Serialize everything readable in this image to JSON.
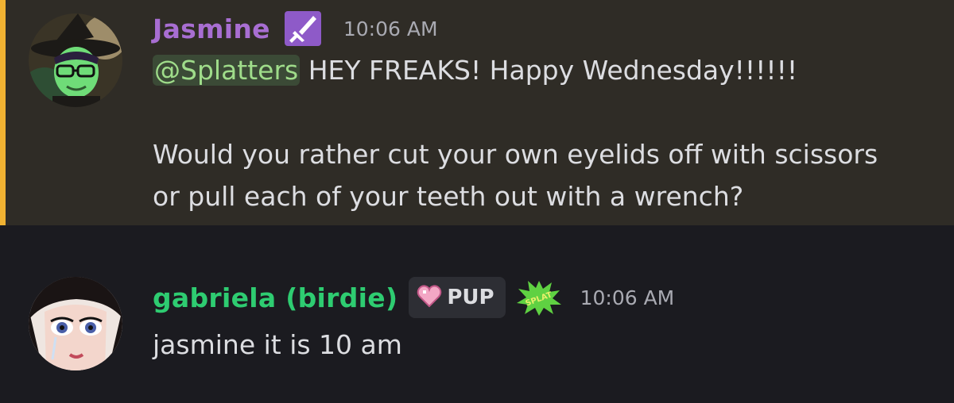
{
  "messages": [
    {
      "author": "Jasmine",
      "role_icon": "sword-icon",
      "timestamp": "10:06 AM",
      "mention": "@Splatters",
      "line1_text": " HEY FREAKS! Happy Wednesday!!!!!!",
      "line2": "Would you rather cut your own eyelids off with scissors",
      "line3": "or pull each of your teeth out with a wrench?",
      "author_color": "#a86ed2",
      "highlighted": true,
      "highlight_color": "#f0b232"
    },
    {
      "author": "gabriela (birdie)",
      "tag_icon": "pink-heart-icon",
      "tag_label": "PUP",
      "badge_icon": "splat-icon",
      "badge_text": "SPLAT",
      "timestamp": "10:06 AM",
      "text": "jasmine it is 10 am",
      "author_color": "#2ecc71"
    }
  ],
  "colors": {
    "mention_background": "#2f2c26",
    "app_background": "#1b1b20",
    "text": "#dcdde1",
    "timestamp": "#a9aab2"
  }
}
